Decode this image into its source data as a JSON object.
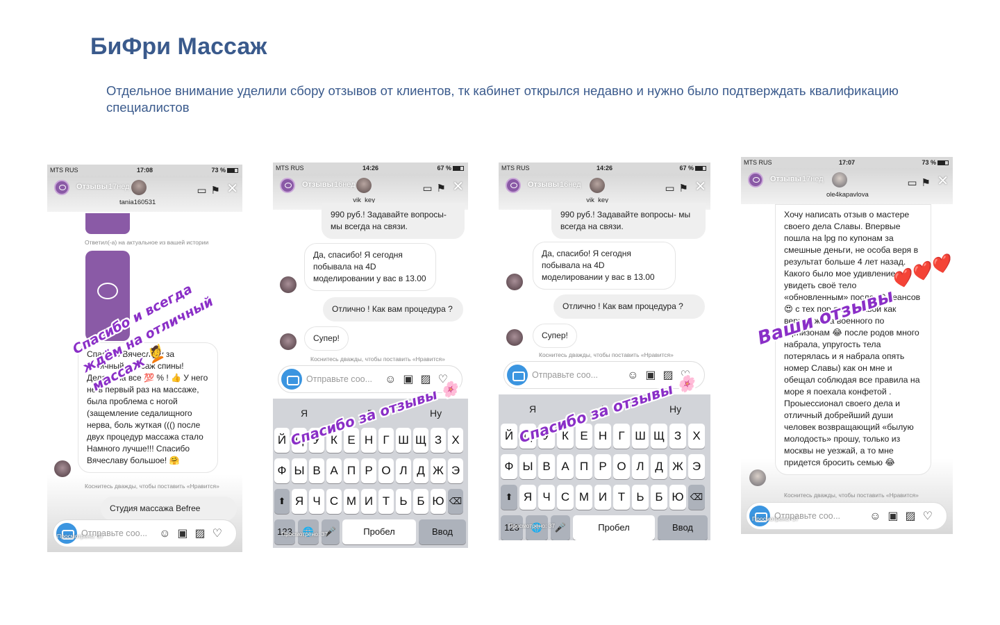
{
  "title": "БиФри Массаж",
  "subtitle": "Отдельное внимание уделили сбору отзывов от клиентов, тк кабинет открылся недавно и нужно было подтверждать квалификацию специалистов",
  "common": {
    "carrier": "MTS RUS",
    "stories_label": "Отзывы",
    "age": "17нед",
    "age_short": "16нед",
    "input_placeholder": "Отправьте соо...",
    "double_tap_hint": "Коснитесь дважды, чтобы поставить «Нравится»",
    "seen": "Просмотрено: 37",
    "keyboard": {
      "suggestions": [
        "Я",
        "В",
        "Ну"
      ],
      "row1": [
        "Й",
        "Ц",
        "У",
        "К",
        "Е",
        "Н",
        "Г",
        "Ш",
        "Щ",
        "З",
        "Х"
      ],
      "row2": [
        "Ф",
        "Ы",
        "В",
        "А",
        "П",
        "Р",
        "О",
        "Л",
        "Д",
        "Ж",
        "Э"
      ],
      "row3": [
        "Я",
        "Ч",
        "С",
        "М",
        "И",
        "Т",
        "Ь",
        "Б",
        "Ю"
      ],
      "num_key": "123",
      "space": "Пробел",
      "enter": "Ввод"
    }
  },
  "screens": [
    {
      "time": "17:08",
      "battery": "73 %",
      "username": "tania160531",
      "reply_note": "Ответил(-а) на актуальное из вашей истории",
      "review": "Спасибо Вячеславу за отличный массаж спины! Делает на все 💯 % ! 👍 У него не в первый раз на массаже, была проблема с ногой (защемление седалищного нерва, боль жуткая ((() после двух процедур массажа стало Намного лучше!!! Спасибо Вячеславу большое! 🤗",
      "studio_msg": "Студия массажа Befree",
      "sticker": "Спасибо и всегда ждём на отличный массаж 💆"
    },
    {
      "time": "14:26",
      "battery": "67 %",
      "username": "_vik_key_",
      "prev_msg": "990 руб.! Задавайте вопросы- мы всегда на связи.",
      "client_msg": "Да, спасибо! Я сегодня побывала на 4D моделировании у вас в 13.00",
      "studio_msg": "Отлично ! Как вам процедура ?",
      "client_reply": "Супер!",
      "sticker": "Спасибо за отзывы 🌸"
    },
    {
      "time": "14:26",
      "battery": "67 %",
      "username": "_vik_key_",
      "prev_msg": "990 руб.! Задавайте вопросы- мы всегда на связи.",
      "client_msg": "Да, спасибо! Я сегодня побывала на 4D моделировании у вас в 13.00",
      "studio_msg": "Отлично ! Как вам процедура ?",
      "client_reply": "Супер!",
      "sticker": "Спасибо за отзывы 🌸"
    },
    {
      "time": "17:07",
      "battery": "73 %",
      "username": "ole4kapavlova",
      "review": "Хочу написать отзыв о мастере своего дела Славы. Впервые пошла на lpg по купонам за смешные деньги, не особа веря в результат больше 4 лет назад. Какого было мое удивление увидеть своё тело «обновленным» после 10 сеансов 😍 с тех пор я за Славой как верная жена военного по гарнизонам 😂 после родов много набрала, упругость тела потерялась и я набрала опять номер Славы) как он мне и обещал соблюдая все правила на море я поехала конфетой . Проыессионал своего дела и отличный добрейший души человек возвращающий «былую молодость» прошу, только из москвы не уезжай, а то мне придется бросить семью 😂",
      "sticker": "Ваши отзывы",
      "hearts": "❤️❤️❤️"
    }
  ]
}
